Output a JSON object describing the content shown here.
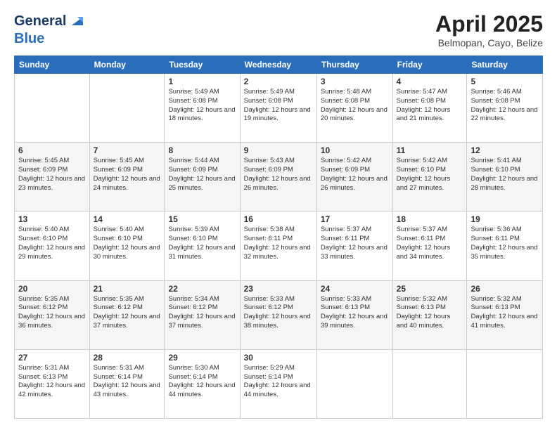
{
  "logo": {
    "line1": "General",
    "line2": "Blue"
  },
  "header": {
    "title": "April 2025",
    "subtitle": "Belmopan, Cayo, Belize"
  },
  "days": [
    "Sunday",
    "Monday",
    "Tuesday",
    "Wednesday",
    "Thursday",
    "Friday",
    "Saturday"
  ],
  "weeks": [
    [
      {
        "num": "",
        "sunrise": "",
        "sunset": "",
        "daylight": ""
      },
      {
        "num": "",
        "sunrise": "",
        "sunset": "",
        "daylight": ""
      },
      {
        "num": "1",
        "sunrise": "Sunrise: 5:49 AM",
        "sunset": "Sunset: 6:08 PM",
        "daylight": "Daylight: 12 hours and 18 minutes."
      },
      {
        "num": "2",
        "sunrise": "Sunrise: 5:49 AM",
        "sunset": "Sunset: 6:08 PM",
        "daylight": "Daylight: 12 hours and 19 minutes."
      },
      {
        "num": "3",
        "sunrise": "Sunrise: 5:48 AM",
        "sunset": "Sunset: 6:08 PM",
        "daylight": "Daylight: 12 hours and 20 minutes."
      },
      {
        "num": "4",
        "sunrise": "Sunrise: 5:47 AM",
        "sunset": "Sunset: 6:08 PM",
        "daylight": "Daylight: 12 hours and 21 minutes."
      },
      {
        "num": "5",
        "sunrise": "Sunrise: 5:46 AM",
        "sunset": "Sunset: 6:08 PM",
        "daylight": "Daylight: 12 hours and 22 minutes."
      }
    ],
    [
      {
        "num": "6",
        "sunrise": "Sunrise: 5:45 AM",
        "sunset": "Sunset: 6:09 PM",
        "daylight": "Daylight: 12 hours and 23 minutes."
      },
      {
        "num": "7",
        "sunrise": "Sunrise: 5:45 AM",
        "sunset": "Sunset: 6:09 PM",
        "daylight": "Daylight: 12 hours and 24 minutes."
      },
      {
        "num": "8",
        "sunrise": "Sunrise: 5:44 AM",
        "sunset": "Sunset: 6:09 PM",
        "daylight": "Daylight: 12 hours and 25 minutes."
      },
      {
        "num": "9",
        "sunrise": "Sunrise: 5:43 AM",
        "sunset": "Sunset: 6:09 PM",
        "daylight": "Daylight: 12 hours and 26 minutes."
      },
      {
        "num": "10",
        "sunrise": "Sunrise: 5:42 AM",
        "sunset": "Sunset: 6:09 PM",
        "daylight": "Daylight: 12 hours and 26 minutes."
      },
      {
        "num": "11",
        "sunrise": "Sunrise: 5:42 AM",
        "sunset": "Sunset: 6:10 PM",
        "daylight": "Daylight: 12 hours and 27 minutes."
      },
      {
        "num": "12",
        "sunrise": "Sunrise: 5:41 AM",
        "sunset": "Sunset: 6:10 PM",
        "daylight": "Daylight: 12 hours and 28 minutes."
      }
    ],
    [
      {
        "num": "13",
        "sunrise": "Sunrise: 5:40 AM",
        "sunset": "Sunset: 6:10 PM",
        "daylight": "Daylight: 12 hours and 29 minutes."
      },
      {
        "num": "14",
        "sunrise": "Sunrise: 5:40 AM",
        "sunset": "Sunset: 6:10 PM",
        "daylight": "Daylight: 12 hours and 30 minutes."
      },
      {
        "num": "15",
        "sunrise": "Sunrise: 5:39 AM",
        "sunset": "Sunset: 6:10 PM",
        "daylight": "Daylight: 12 hours and 31 minutes."
      },
      {
        "num": "16",
        "sunrise": "Sunrise: 5:38 AM",
        "sunset": "Sunset: 6:11 PM",
        "daylight": "Daylight: 12 hours and 32 minutes."
      },
      {
        "num": "17",
        "sunrise": "Sunrise: 5:37 AM",
        "sunset": "Sunset: 6:11 PM",
        "daylight": "Daylight: 12 hours and 33 minutes."
      },
      {
        "num": "18",
        "sunrise": "Sunrise: 5:37 AM",
        "sunset": "Sunset: 6:11 PM",
        "daylight": "Daylight: 12 hours and 34 minutes."
      },
      {
        "num": "19",
        "sunrise": "Sunrise: 5:36 AM",
        "sunset": "Sunset: 6:11 PM",
        "daylight": "Daylight: 12 hours and 35 minutes."
      }
    ],
    [
      {
        "num": "20",
        "sunrise": "Sunrise: 5:35 AM",
        "sunset": "Sunset: 6:12 PM",
        "daylight": "Daylight: 12 hours and 36 minutes."
      },
      {
        "num": "21",
        "sunrise": "Sunrise: 5:35 AM",
        "sunset": "Sunset: 6:12 PM",
        "daylight": "Daylight: 12 hours and 37 minutes."
      },
      {
        "num": "22",
        "sunrise": "Sunrise: 5:34 AM",
        "sunset": "Sunset: 6:12 PM",
        "daylight": "Daylight: 12 hours and 37 minutes."
      },
      {
        "num": "23",
        "sunrise": "Sunrise: 5:33 AM",
        "sunset": "Sunset: 6:12 PM",
        "daylight": "Daylight: 12 hours and 38 minutes."
      },
      {
        "num": "24",
        "sunrise": "Sunrise: 5:33 AM",
        "sunset": "Sunset: 6:13 PM",
        "daylight": "Daylight: 12 hours and 39 minutes."
      },
      {
        "num": "25",
        "sunrise": "Sunrise: 5:32 AM",
        "sunset": "Sunset: 6:13 PM",
        "daylight": "Daylight: 12 hours and 40 minutes."
      },
      {
        "num": "26",
        "sunrise": "Sunrise: 5:32 AM",
        "sunset": "Sunset: 6:13 PM",
        "daylight": "Daylight: 12 hours and 41 minutes."
      }
    ],
    [
      {
        "num": "27",
        "sunrise": "Sunrise: 5:31 AM",
        "sunset": "Sunset: 6:13 PM",
        "daylight": "Daylight: 12 hours and 42 minutes."
      },
      {
        "num": "28",
        "sunrise": "Sunrise: 5:31 AM",
        "sunset": "Sunset: 6:14 PM",
        "daylight": "Daylight: 12 hours and 43 minutes."
      },
      {
        "num": "29",
        "sunrise": "Sunrise: 5:30 AM",
        "sunset": "Sunset: 6:14 PM",
        "daylight": "Daylight: 12 hours and 44 minutes."
      },
      {
        "num": "30",
        "sunrise": "Sunrise: 5:29 AM",
        "sunset": "Sunset: 6:14 PM",
        "daylight": "Daylight: 12 hours and 44 minutes."
      },
      {
        "num": "",
        "sunrise": "",
        "sunset": "",
        "daylight": ""
      },
      {
        "num": "",
        "sunrise": "",
        "sunset": "",
        "daylight": ""
      },
      {
        "num": "",
        "sunrise": "",
        "sunset": "",
        "daylight": ""
      }
    ]
  ]
}
